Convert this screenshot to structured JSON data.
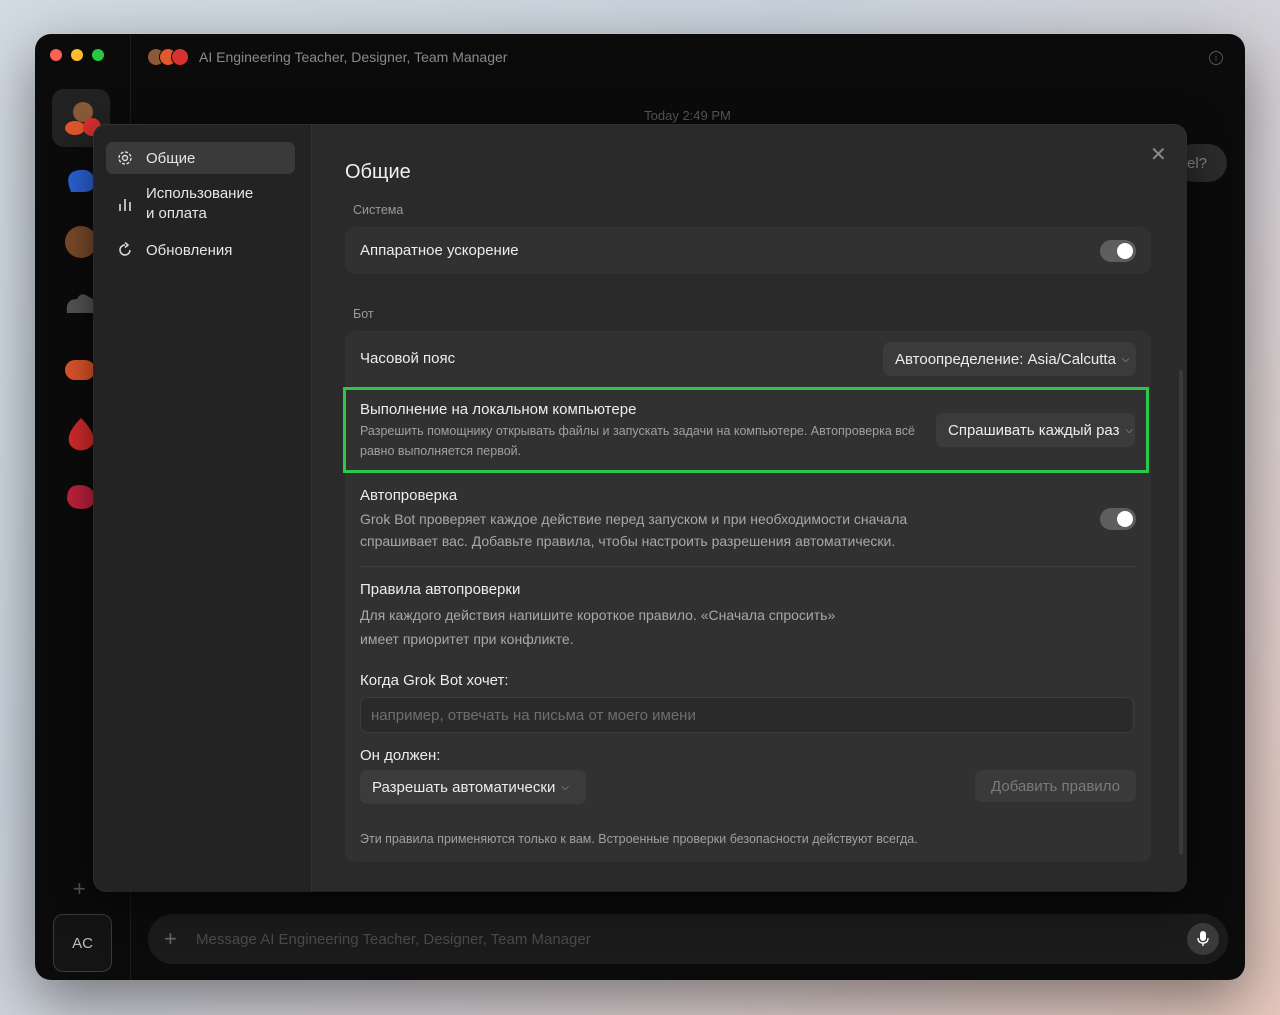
{
  "window": {
    "title": "AI Engineering Teacher, Designer, Team Manager",
    "timestamp": "Today 2:49 PM",
    "bubble_peek": "el?",
    "composer_placeholder": "Message AI Engineering Teacher, Designer, Team Manager",
    "user_initials": "AC"
  },
  "settings": {
    "nav": [
      {
        "label": "Общие",
        "icon": "gear-icon"
      },
      {
        "label": "Использование\nи оплата",
        "icon": "bar-chart-icon"
      },
      {
        "label": "Обновления",
        "icon": "refresh-icon"
      }
    ],
    "heading": "Общие",
    "system": {
      "section_label": "Система",
      "hw_accel_label": "Аппаратное ускорение",
      "hw_accel_on": true
    },
    "bot": {
      "section_label": "Бот",
      "timezone_label": "Часовой пояс",
      "timezone_value": "Автоопределение: Asia/Calcutta",
      "local_exec_label": "Выполнение на локальном компьютере",
      "local_exec_desc": "Разрешить помощнику открывать файлы и запускать задачи на компьютере. Автопроверка всё равно выполняется первой.",
      "local_exec_value": "Спрашивать каждый раз",
      "autocheck_label": "Автопроверка",
      "autocheck_desc": "Grok Bot проверяет каждое действие перед запуском и при необходимости сначала спрашивает вас. Добавьте правила, чтобы настроить разрешения автоматически.",
      "autocheck_on": true,
      "rules_title": "Правила автопроверки",
      "rules_desc": "Для каждого действия напишите короткое правило. «Сначала спросить» имеет приоритет при конфликте.",
      "when_label": "Когда Grok Bot хочет:",
      "when_placeholder": "например, отвечать на письма от моего имени",
      "should_label": "Он должен:",
      "should_value": "Разрешать автоматически",
      "add_rule_button": "Добавить правило",
      "footer_note": "Эти правила применяются только к вам. Встроенные проверки безопасности действуют всегда."
    }
  },
  "colors": {
    "highlight": "#2bc84b",
    "traffic_red": "#fe5f57",
    "traffic_yellow": "#febc2e",
    "traffic_green": "#28c840"
  }
}
